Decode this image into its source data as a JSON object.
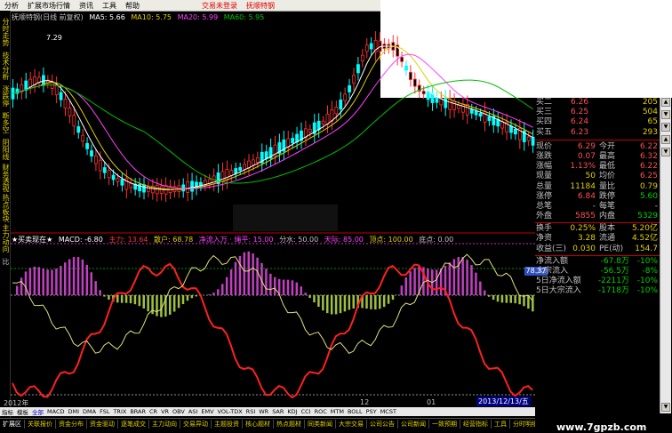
{
  "menu": [
    "分析",
    "扩展市场行情",
    "资讯",
    "工具",
    "帮助",
    "交易未登录",
    "抚顺特钢"
  ],
  "left_tools": [
    "分时走势",
    "技术分析",
    "涨跌停",
    "断多空",
    "阴阳线",
    "财务透视",
    "热点板块",
    "主力动向",
    "比"
  ],
  "main_info": {
    "title": "抚顺特钢(日线 前复权)",
    "ma5": "MA5: 5.66",
    "ma10": "MA10: 5.75",
    "ma20": "MA20: 5.99",
    "ma60": "MA60: 5.95",
    "high_label": "7.29"
  },
  "sub_info": {
    "name": "★买卖现在★",
    "macd": "MACD: -6.80",
    "zhuli": "主力: 13.64",
    "sanhu": "散户: 68.78",
    "jlr": "净流入万 · 绳平: 15.00",
    "fenshui": "分水: 50.00",
    "tianding": "天际: 85.00",
    "dingdian": "顶点: 100.00",
    "didian": "底点: 0.00",
    "price_tag": "78.37"
  },
  "quote": {
    "asks": [
      {
        "label": "买二",
        "price": "6.26",
        "vol": "205"
      },
      {
        "label": "买三",
        "price": "6.25",
        "vol": "504"
      },
      {
        "label": "买四",
        "price": "6.24",
        "vol": "65"
      },
      {
        "label": "买五",
        "price": "6.23",
        "vol": "293"
      }
    ],
    "rows": [
      {
        "l1": "现价",
        "v1": "6.29",
        "l2": "今开",
        "v2": "6.22",
        "c1": "#ff5050",
        "c2": "#ff5050"
      },
      {
        "l1": "涨跌",
        "v1": "0.07",
        "l2": "最高",
        "v2": "6.32",
        "c1": "#ff5050",
        "c2": "#ff5050"
      },
      {
        "l1": "涨幅",
        "v1": "1.13%",
        "l2": "最低",
        "v2": "6.22",
        "c1": "#ff5050",
        "c2": "#ff5050"
      },
      {
        "l1": "现量",
        "v1": "50",
        "l2": "均价",
        "v2": "6.25",
        "c1": "#e0d000",
        "c2": "#ff5050"
      },
      {
        "l1": "总量",
        "v1": "11184",
        "l2": "量比",
        "v2": "0.79",
        "c1": "#e0d000",
        "c2": "#e0d000"
      },
      {
        "l1": "涨停",
        "v1": "6.84",
        "l2": "跌停",
        "v2": "5.60",
        "c1": "#ff5050",
        "c2": "#00d000"
      },
      {
        "l1": "总笔",
        "v1": "-",
        "l2": "每笔",
        "v2": "-",
        "c1": "#c0c0c0",
        "c2": "#c0c0c0"
      },
      {
        "l1": "外盘",
        "v1": "5855",
        "l2": "内盘",
        "v2": "5329",
        "c1": "#ff5050",
        "c2": "#00d000"
      },
      {
        "l1": "换手",
        "v1": "0.25%",
        "l2": "股本",
        "v2": "5.20亿",
        "c1": "#e0d000",
        "c2": "#e0d000"
      },
      {
        "l1": "净资",
        "v1": "3.28",
        "l2": "流通",
        "v2": "4.52亿",
        "c1": "#e0d000",
        "c2": "#e0d000"
      },
      {
        "l1": "收益(三)",
        "v1": "0.030",
        "l2": "PE(动)",
        "v2": "154.7",
        "c1": "#e0d000",
        "c2": "#e0d000"
      }
    ],
    "flows": [
      {
        "label": "净流入额",
        "val": "-67.8万",
        "pct": "-10%"
      },
      {
        "label": "大宗流入",
        "val": "-56.5万",
        "pct": "-8%"
      },
      {
        "label": "5日净流入额",
        "val": "-2211万",
        "pct": "-10%"
      },
      {
        "label": "5日大宗流入",
        "val": "-1718万",
        "pct": "-10%"
      }
    ]
  },
  "date_labels": {
    "left": "2012年",
    "mid": "12",
    "mid2": "01",
    "mid3": "2013/12/13/五"
  },
  "indicators": [
    "指标",
    "模板",
    "全部",
    "MACD",
    "DMI",
    "DMA",
    "FSL",
    "TRIX",
    "BRAR",
    "CR",
    "VR",
    "OBV",
    "ASI",
    "EMV",
    "VOL-TDX",
    "RSI",
    "WR",
    "SAR",
    "KDJ",
    "CCI",
    "ROC",
    "MTM",
    "BOLL",
    "PSY",
    "MCST"
  ],
  "tabs": [
    "扩展区",
    "关联报价",
    "资金分布",
    "资金驱动",
    "逐笔成交",
    "主力动向",
    "交易异动",
    "主题投资",
    "核心题材",
    "热点题材",
    "同类新闻",
    "大宗交易",
    "公司公告",
    "公司新闻",
    "一致预期",
    "经营指标",
    "工具",
    "分时明细",
    "分价表",
    "账户"
  ],
  "watermark": "www.7gpzb.com",
  "colors": {
    "up": "#ff3030",
    "down": "#00ffff",
    "ma5": "#ffffff",
    "ma10": "#e0d000",
    "ma20": "#ff40ff",
    "ma60": "#00c000"
  }
}
